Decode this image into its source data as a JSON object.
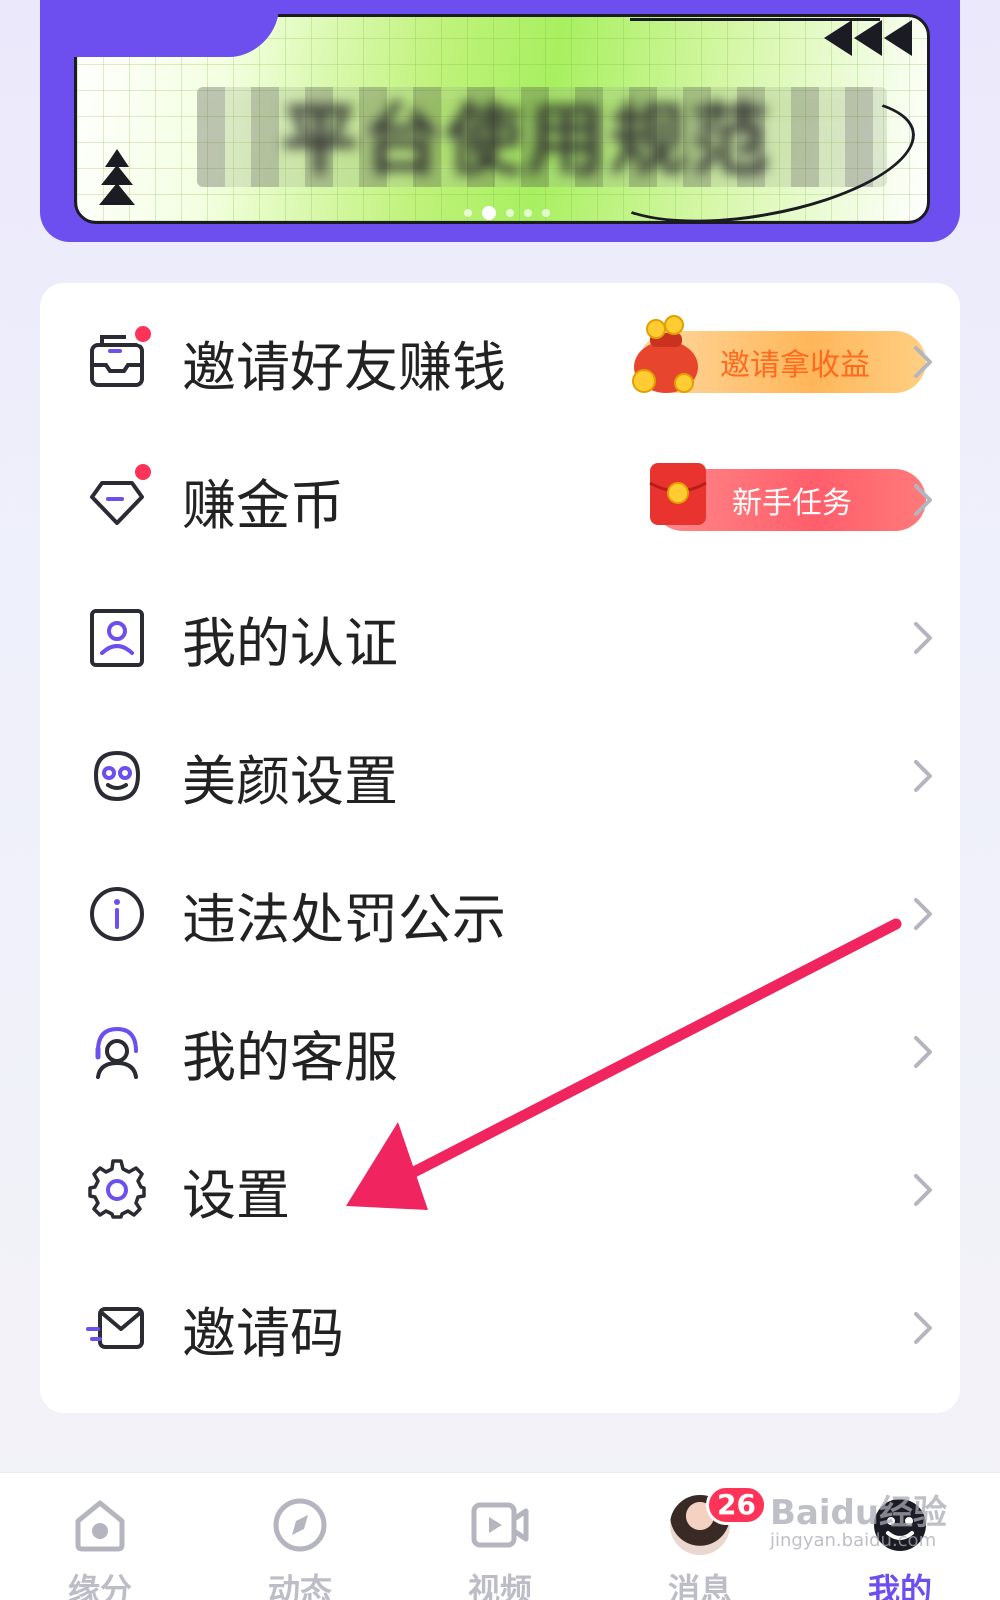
{
  "banner": {
    "title": "平台使用规范",
    "slide_count": 5,
    "active_slide": 2
  },
  "menu": {
    "items": [
      {
        "id": "invite-friends",
        "label": "邀请好友赚钱",
        "icon": "envelope-icon",
        "has_dot": true,
        "promo": "邀请拿收益"
      },
      {
        "id": "earn-coins",
        "label": "赚金币",
        "icon": "diamond-icon",
        "has_dot": true,
        "promo": "新手任务"
      },
      {
        "id": "my-verification",
        "label": "我的认证",
        "icon": "id-card-icon",
        "has_dot": false
      },
      {
        "id": "beauty-settings",
        "label": "美颜设置",
        "icon": "face-icon",
        "has_dot": false
      },
      {
        "id": "violation-notice",
        "label": "违法处罚公示",
        "icon": "info-icon",
        "has_dot": false
      },
      {
        "id": "customer-service",
        "label": "我的客服",
        "icon": "headset-icon",
        "has_dot": false
      },
      {
        "id": "settings",
        "label": "设置",
        "icon": "gear-icon",
        "has_dot": false
      },
      {
        "id": "invite-code",
        "label": "邀请码",
        "icon": "mail-fast-icon",
        "has_dot": false
      }
    ]
  },
  "bottom_nav": {
    "items": [
      {
        "id": "fate",
        "label": "缘分",
        "icon": "home-icon",
        "active": false
      },
      {
        "id": "moments",
        "label": "动态",
        "icon": "compass-icon",
        "active": false
      },
      {
        "id": "video",
        "label": "视频",
        "icon": "video-icon",
        "active": false
      },
      {
        "id": "messages",
        "label": "消息",
        "icon": "avatar",
        "active": false,
        "badge": "26"
      },
      {
        "id": "mine",
        "label": "我的",
        "icon": "smiley-icon",
        "active": true
      }
    ]
  },
  "watermark": {
    "text": "Baidu经验",
    "sub": "jingyan.baidu.com"
  },
  "colors": {
    "accent": "#6d4ff0",
    "red_dot": "#ff3357",
    "annotation_arrow": "#f0245f",
    "inactive_nav": "#bdbdc8"
  }
}
